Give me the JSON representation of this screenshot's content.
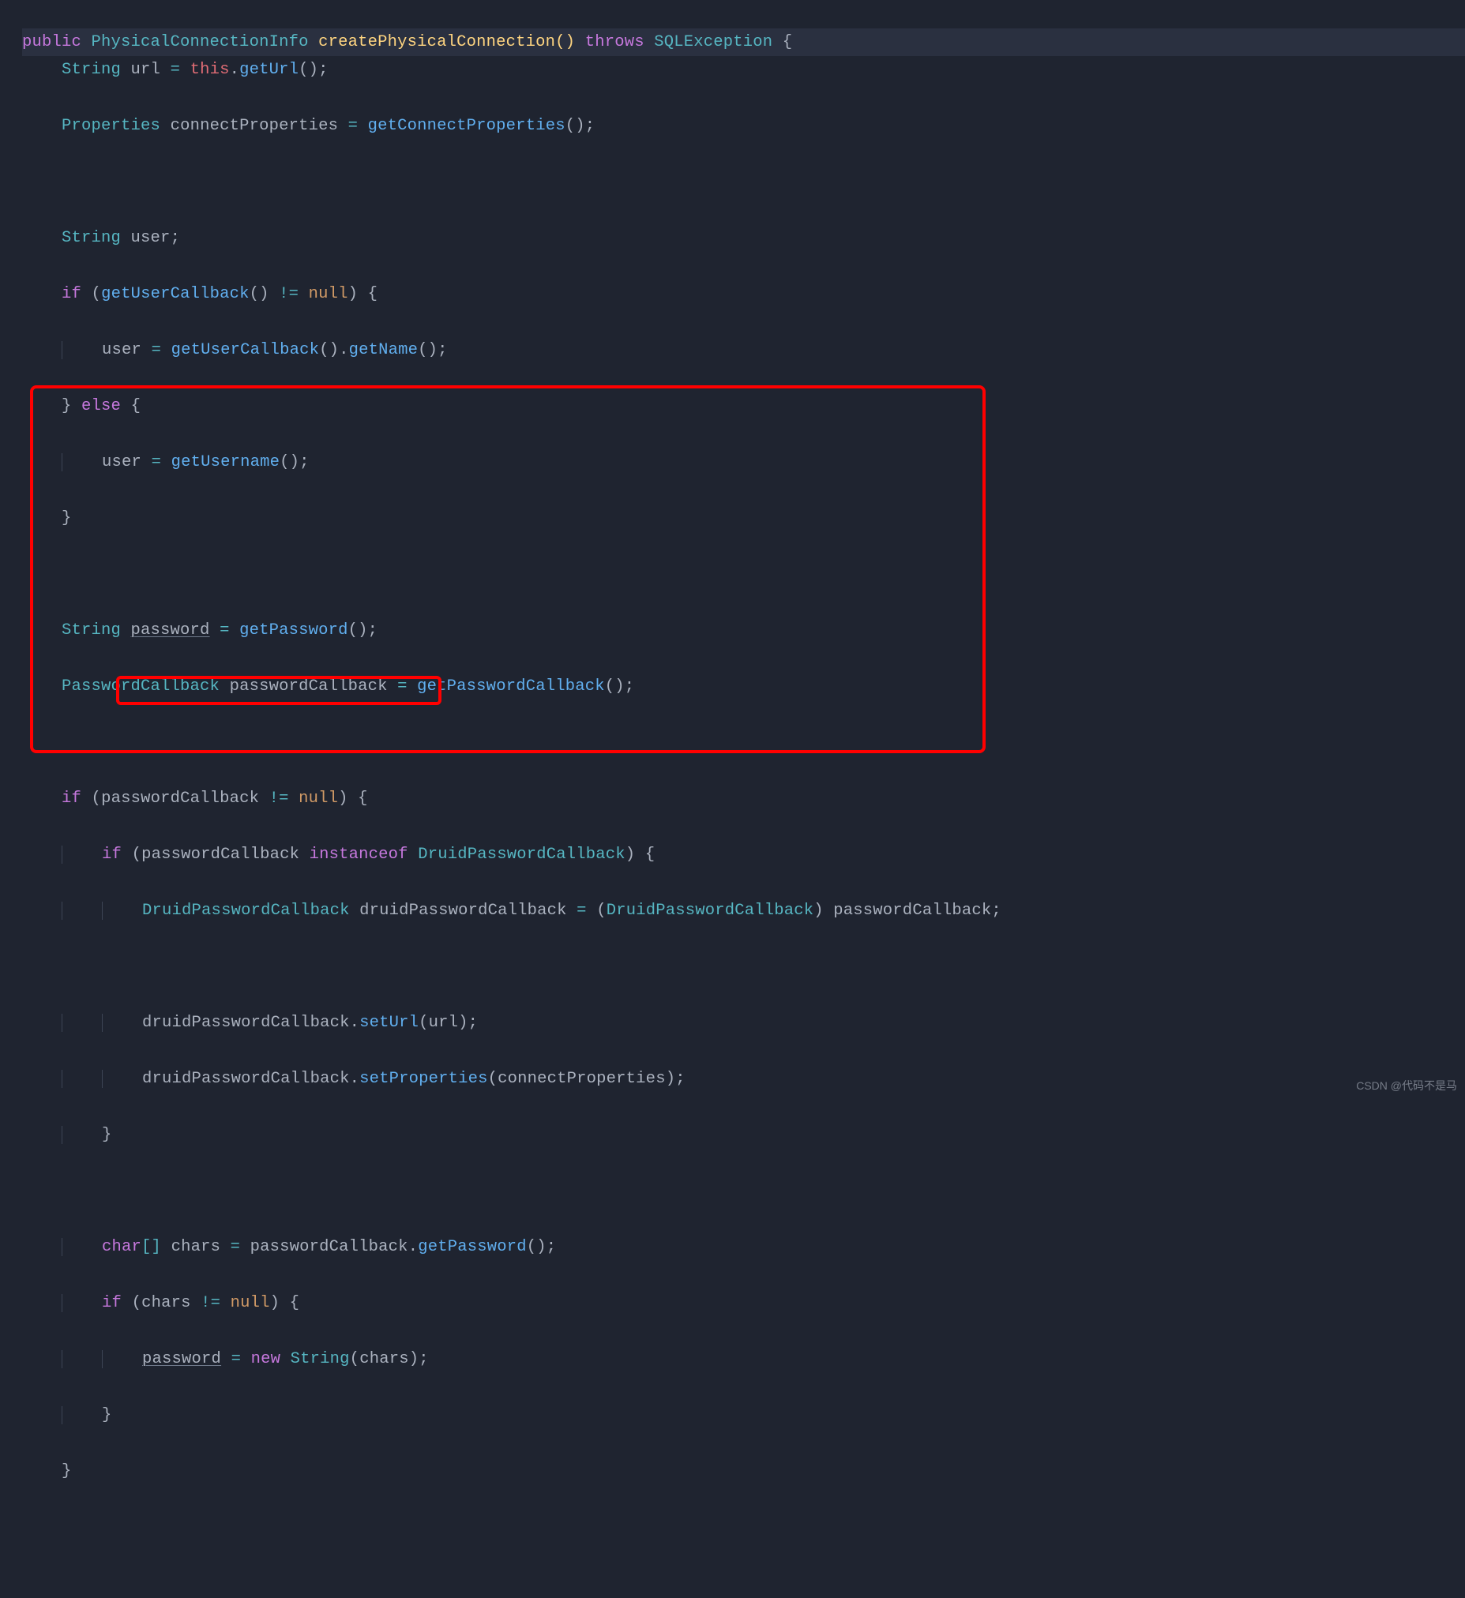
{
  "code": {
    "sig_public": "public",
    "sig_type": "PhysicalConnectionInfo",
    "sig_method": "createPhysicalConnection",
    "sig_throws": "throws",
    "sig_exc": "SQLException",
    "l2_type": "String",
    "l2_var": "url",
    "l2_this": "this",
    "l2_call": "getUrl",
    "l3_type": "Properties",
    "l3_var": "connectProperties",
    "l3_call": "getConnectProperties",
    "l5_type": "String",
    "l5_var": "user",
    "l6_if": "if",
    "l6_call": "getUserCallback",
    "l6_op": "!=",
    "l6_null": "null",
    "l7_var": "user",
    "l7_call1": "getUserCallback",
    "l7_call2": "getName",
    "l8_else": "else",
    "l9_var": "user",
    "l9_call": "getUsername",
    "l12_type": "String",
    "l12_var": "password",
    "l12_call": "getPassword",
    "l13_type": "PasswordCallback",
    "l13_var": "passwordCallback",
    "l13_call": "getPasswordCallback",
    "l15_if": "if",
    "l15_var": "passwordCallback",
    "l15_op": "!=",
    "l15_null": "null",
    "l16_if": "if",
    "l16_var": "passwordCallback",
    "l16_inst": "instanceof",
    "l16_type": "DruidPasswordCallback",
    "l17_type": "DruidPasswordCallback",
    "l17_var": "druidPasswordCallback",
    "l17_cast": "DruidPasswordCallback",
    "l17_src": "passwordCallback",
    "l19_var": "druidPasswordCallback",
    "l19_call": "setUrl",
    "l19_arg": "url",
    "l20_var": "druidPasswordCallback",
    "l20_call": "setProperties",
    "l20_arg": "connectProperties",
    "l23_kw": "char",
    "l23_var": "chars",
    "l23_src": "passwordCallback",
    "l23_call": "getPassword",
    "l24_if": "if",
    "l24_var": "chars",
    "l24_op": "!=",
    "l24_null": "null",
    "l25_var": "password",
    "l25_new": "new",
    "l25_type": "String",
    "l25_arg": "chars"
  },
  "watermark": "CSDN @代码不是马"
}
